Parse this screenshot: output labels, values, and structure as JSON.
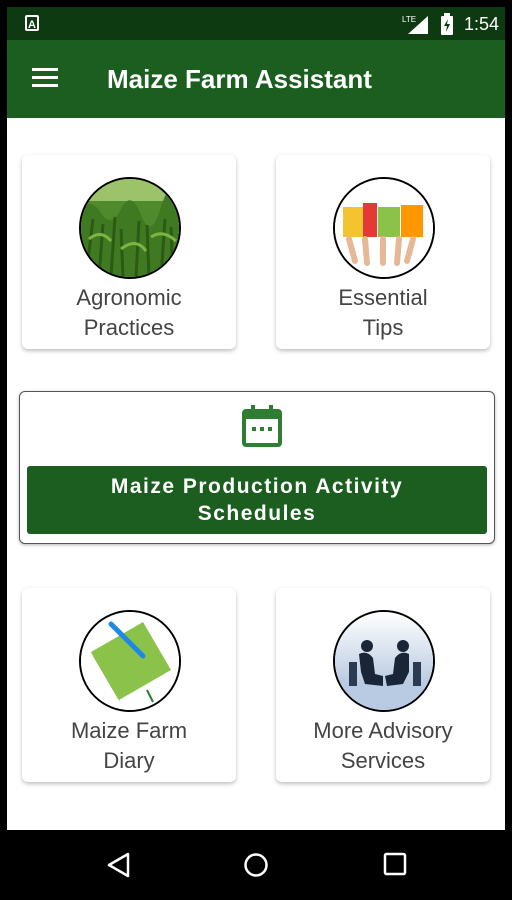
{
  "status_bar": {
    "notification": "A",
    "network": "LTE",
    "time": "1:54"
  },
  "app_bar": {
    "title": "Maize Farm Assistant",
    "menu_icon": "hamburger-menu-icon"
  },
  "cards": [
    {
      "label": "Agronomic\nPractices",
      "icon": "maize-field-image"
    },
    {
      "label": "Essential\nTips",
      "icon": "tips-image"
    },
    {
      "label": "Maize Farm\nDiary",
      "icon": "diary-notebook-image"
    },
    {
      "label": "More Advisory\nServices",
      "icon": "advisory-meeting-image"
    }
  ],
  "schedule": {
    "icon": "calendar-icon",
    "button_label": "Maize Production Activity\nSchedules"
  },
  "nav_bar": {
    "back": "back-icon",
    "home": "home-icon",
    "recents": "recents-icon"
  },
  "colors": {
    "primary": "#1b5e20",
    "status_bar": "#0d3a11",
    "accent_green": "#2e7d32"
  }
}
